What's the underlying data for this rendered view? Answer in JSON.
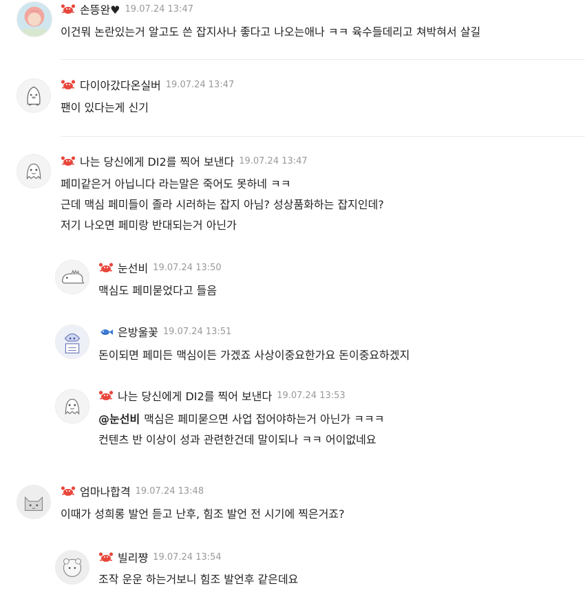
{
  "comments": [
    {
      "nick": "손뜽완♥",
      "date": "19.07.24 13:47",
      "level_icon": "crab-icon",
      "avatar": "photo-avatar",
      "lines": [
        "이건뭐 논란있는거 알고도 쓴 잡지사나 좋다고 나오는애나 ㅋㅋ 육수들데리고 쳐박혀서 살길"
      ]
    },
    {
      "nick": "다이아갔다온실버",
      "date": "19.07.24 13:47",
      "level_icon": "crab-icon",
      "avatar": "penguin-avatar",
      "lines": [
        "팬이 있다는게 신기"
      ]
    },
    {
      "nick": "나는 당신에게 DI2를 찍어 보낸다",
      "date": "19.07.24 13:47",
      "level_icon": "crab-icon",
      "avatar": "ghost-avatar",
      "lines": [
        "페미같은거 아닙니다 라는말은 죽어도 못하네 ㅋㅋ",
        "근데 맥심 페미들이 졸라 시러하는 잡지 아님? 성상품화하는 잡지인데?",
        "저기 나오면 페미랑 반대되는거 아닌가"
      ]
    },
    {
      "nick": "눈선비",
      "date": "19.07.24 13:50",
      "level_icon": "crab-icon",
      "avatar": "dino-avatar",
      "lines": [
        "맥심도 페미묻었다고 들음"
      ]
    },
    {
      "nick": "은방울꽃",
      "date": "19.07.24 13:51",
      "level_icon": "fish-icon",
      "avatar": "robot-avatar",
      "lines": [
        "돈이되면 페미든 맥심이든 가겠죠 사상이중요한가요 돈이중요하겠지"
      ]
    },
    {
      "nick": "나는 당신에게 DI2를 찍어 보낸다",
      "date": "19.07.24 13:53",
      "level_icon": "crab-icon",
      "avatar": "ghost-avatar",
      "mention": "@눈선비",
      "lines": [
        "맥심은 페미묻으면 사업 접어야하는거 아닌가 ㅋㅋㅋ",
        "컨텐츠 반 이상이 성과 관련한건데 말이되나 ㅋㅋ 어이없네요"
      ]
    },
    {
      "nick": "엄마나합격",
      "date": "19.07.24 13:48",
      "level_icon": "crab-icon",
      "avatar": "cat-avatar",
      "lines": [
        "이때가 성희롱 발언 듣고 난후, 힘조 발언 전 시기에 찍은거죠?"
      ]
    },
    {
      "nick": "빌리쨩",
      "date": "19.07.24 13:54",
      "level_icon": "crab-icon",
      "avatar": "sheep-avatar",
      "lines": [
        "조작 운운 하는거보니 힘조 발언후 같은데요"
      ]
    }
  ],
  "colors": {
    "nick": "#222222",
    "date": "#999999",
    "body": "#222222",
    "crab": "#e8473c",
    "fish": "#3a7bd5",
    "separator": "#ececec"
  }
}
